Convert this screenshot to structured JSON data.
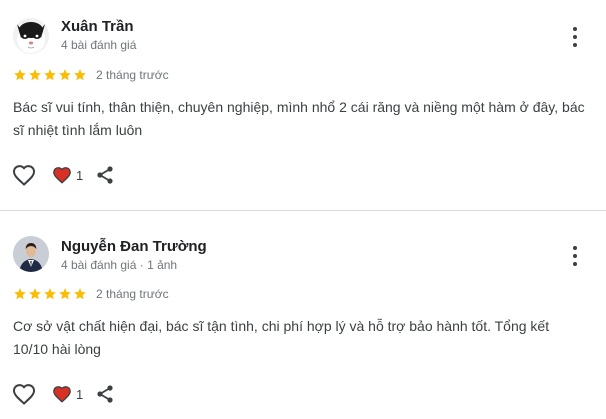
{
  "reviews": [
    {
      "reviewer_name": "Xuân Trần",
      "reviewer_meta": "4 bài đánh giá",
      "rating": 5,
      "time_ago": "2 tháng trước",
      "text": "Bác sĩ vui tính, thân thiện, chuyên nghiệp, mình nhổ 2 cái răng và niềng một hàm ở đây, bác sĩ nhiệt tình lắm luôn",
      "like_count": "1",
      "avatar_icon": "cat-avatar-icon"
    },
    {
      "reviewer_name": "Nguyễn Đan Trường",
      "reviewer_meta": "4 bài đánh giá · 1 ảnh",
      "rating": 5,
      "time_ago": "2 tháng trước",
      "text": "Cơ sở vật chất hiện đại, bác sĩ tận tình, chi phí hợp lý và hỗ trợ bảo hành tốt. Tổng kết 10/10 hài lòng",
      "like_count": "1",
      "avatar_icon": "person-avatar-icon"
    }
  ],
  "colors": {
    "star": "#fbbc04",
    "heart": "#d93025",
    "icon": "#3c4043",
    "divider": "#dadce0"
  }
}
